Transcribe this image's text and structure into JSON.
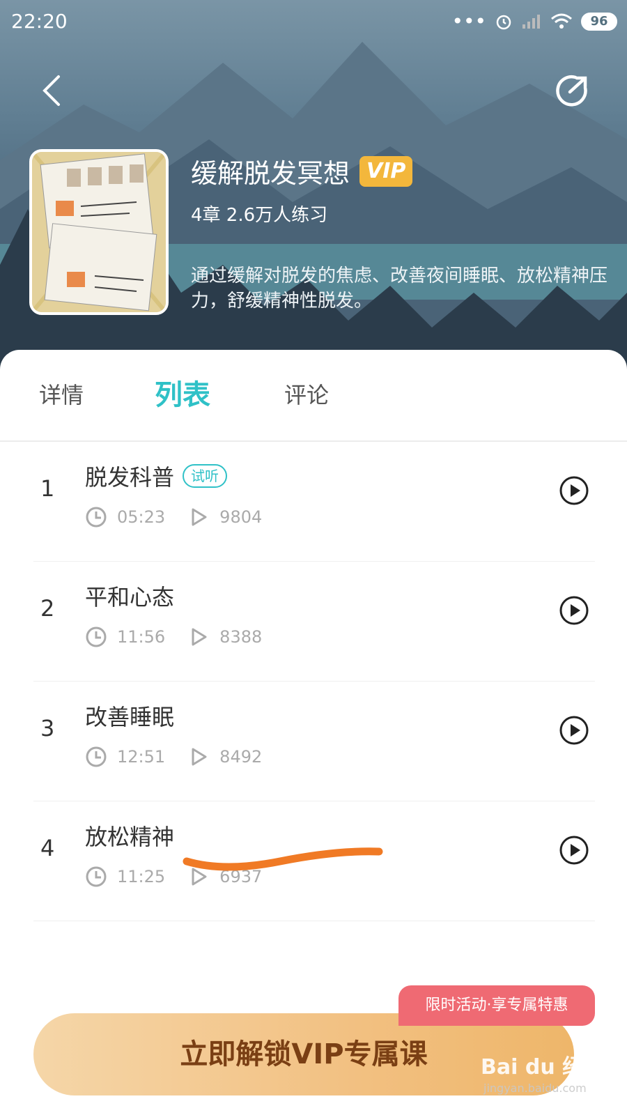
{
  "status_bar": {
    "time": "22:20",
    "dots": "•••",
    "battery": "96"
  },
  "course": {
    "title": "缓解脱发冥想",
    "vip": "VIP",
    "meta": "4章 2.6万人练习",
    "description": "通过缓解对脱发的焦虑、改善夜间睡眠、放松精神压力，舒缓精神性脱发。"
  },
  "tabs": [
    {
      "label": "详情",
      "active": false
    },
    {
      "label": "列表",
      "active": true
    },
    {
      "label": "评论",
      "active": false
    }
  ],
  "chapters": [
    {
      "num": "1",
      "title": "脱发科普",
      "badge": "试听",
      "duration": "05:23",
      "plays": "9804"
    },
    {
      "num": "2",
      "title": "平和心态",
      "badge": "",
      "duration": "11:56",
      "plays": "8388"
    },
    {
      "num": "3",
      "title": "改善睡眠",
      "badge": "",
      "duration": "12:51",
      "plays": "8492"
    },
    {
      "num": "4",
      "title": "放松精神",
      "badge": "",
      "duration": "11:25",
      "plays": "6937"
    }
  ],
  "promo": {
    "tag": "限时活动·享专属特惠",
    "cta": "立即解锁VIP专属课"
  },
  "watermark": {
    "brand": "Bai du 经验",
    "url": "jingyan.baidu.com"
  },
  "colors": {
    "accent": "#2fc1c7",
    "vip": "#f3b73c",
    "promo": "#ef6a73",
    "cta_text": "#7a3f14"
  }
}
